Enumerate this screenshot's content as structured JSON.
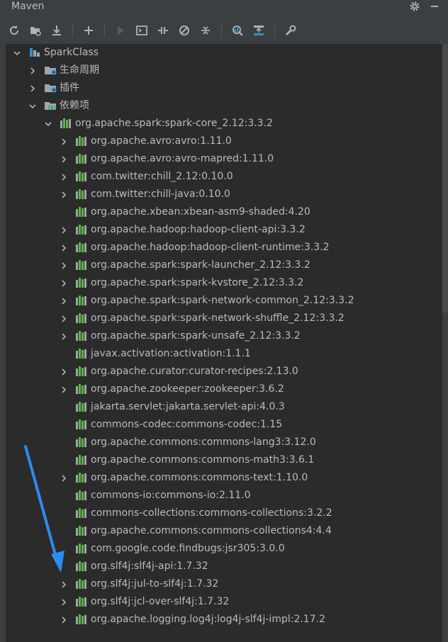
{
  "window": {
    "title": "Maven"
  },
  "toolbar": {
    "buttons": [
      {
        "name": "reload-icon"
      },
      {
        "name": "generate-sources-icon"
      },
      {
        "name": "download-icon"
      },
      {
        "name": "add-icon"
      },
      {
        "name": "run-icon"
      },
      {
        "name": "execute-goal-icon"
      },
      {
        "name": "toggle-offline-icon"
      },
      {
        "name": "skip-tests-icon"
      },
      {
        "name": "collapse-all-icon"
      },
      {
        "name": "analyze-dependencies-icon"
      },
      {
        "name": "show-diagram-icon"
      },
      {
        "name": "settings-wrench-icon"
      }
    ]
  },
  "tree": {
    "rows": [
      {
        "label": "SparkClass",
        "level": 0,
        "expanded": true,
        "icon": "project-icon"
      },
      {
        "label": "生命周期",
        "level": 1,
        "expanded": false,
        "icon": "lifecycle-folder-icon"
      },
      {
        "label": "插件",
        "level": 1,
        "expanded": false,
        "icon": "plugins-folder-icon"
      },
      {
        "label": "依赖项",
        "level": 1,
        "expanded": true,
        "icon": "dependencies-folder-icon"
      },
      {
        "label": "org.apache.spark:spark-core_2.12:3.3.2",
        "level": 2,
        "expanded": true,
        "icon": "library-icon"
      },
      {
        "label": "org.apache.avro:avro:1.11.0",
        "level": 3,
        "expanded": false,
        "icon": "library-icon"
      },
      {
        "label": "org.apache.avro:avro-mapred:1.11.0",
        "level": 3,
        "expanded": false,
        "icon": "library-icon"
      },
      {
        "label": "com.twitter:chill_2.12:0.10.0",
        "level": 3,
        "expanded": false,
        "icon": "library-icon"
      },
      {
        "label": "com.twitter:chill-java:0.10.0",
        "level": 3,
        "expanded": false,
        "icon": "library-icon"
      },
      {
        "label": "org.apache.xbean:xbean-asm9-shaded:4.20",
        "level": 3,
        "leaf": true,
        "icon": "library-icon"
      },
      {
        "label": "org.apache.hadoop:hadoop-client-api:3.3.2",
        "level": 3,
        "expanded": false,
        "icon": "library-icon"
      },
      {
        "label": "org.apache.hadoop:hadoop-client-runtime:3.3.2",
        "level": 3,
        "expanded": false,
        "icon": "library-icon"
      },
      {
        "label": "org.apache.spark:spark-launcher_2.12:3.3.2",
        "level": 3,
        "expanded": false,
        "icon": "library-icon"
      },
      {
        "label": "org.apache.spark:spark-kvstore_2.12:3.3.2",
        "level": 3,
        "expanded": false,
        "icon": "library-icon"
      },
      {
        "label": "org.apache.spark:spark-network-common_2.12:3.3.2",
        "level": 3,
        "expanded": false,
        "icon": "library-icon"
      },
      {
        "label": "org.apache.spark:spark-network-shuffle_2.12:3.3.2",
        "level": 3,
        "expanded": false,
        "icon": "library-icon"
      },
      {
        "label": "org.apache.spark:spark-unsafe_2.12:3.3.2",
        "level": 3,
        "expanded": false,
        "icon": "library-icon"
      },
      {
        "label": "javax.activation:activation:1.1.1",
        "level": 3,
        "leaf": true,
        "icon": "library-icon"
      },
      {
        "label": "org.apache.curator:curator-recipes:2.13.0",
        "level": 3,
        "expanded": false,
        "icon": "library-icon"
      },
      {
        "label": "org.apache.zookeeper:zookeeper:3.6.2",
        "level": 3,
        "expanded": false,
        "icon": "library-icon"
      },
      {
        "label": "jakarta.servlet:jakarta.servlet-api:4.0.3",
        "level": 3,
        "leaf": true,
        "icon": "library-icon"
      },
      {
        "label": "commons-codec:commons-codec:1.15",
        "level": 3,
        "leaf": true,
        "icon": "library-icon"
      },
      {
        "label": "org.apache.commons:commons-lang3:3.12.0",
        "level": 3,
        "leaf": true,
        "icon": "library-icon"
      },
      {
        "label": "org.apache.commons:commons-math3:3.6.1",
        "level": 3,
        "leaf": true,
        "icon": "library-icon"
      },
      {
        "label": "org.apache.commons:commons-text:1.10.0",
        "level": 3,
        "expanded": false,
        "icon": "library-icon"
      },
      {
        "label": "commons-io:commons-io:2.11.0",
        "level": 3,
        "leaf": true,
        "icon": "library-icon"
      },
      {
        "label": "commons-collections:commons-collections:3.2.2",
        "level": 3,
        "leaf": true,
        "icon": "library-icon"
      },
      {
        "label": "org.apache.commons:commons-collections4:4.4",
        "level": 3,
        "leaf": true,
        "icon": "library-icon"
      },
      {
        "label": "com.google.code.findbugs:jsr305:3.0.0",
        "level": 3,
        "leaf": true,
        "icon": "library-icon"
      },
      {
        "label": "org.slf4j:slf4j-api:1.7.32",
        "level": 3,
        "leaf": true,
        "icon": "library-icon"
      },
      {
        "label": "org.slf4j:jul-to-slf4j:1.7.32",
        "level": 3,
        "expanded": false,
        "icon": "library-icon"
      },
      {
        "label": "org.slf4j:jcl-over-slf4j:1.7.32",
        "level": 3,
        "expanded": false,
        "icon": "library-icon"
      },
      {
        "label": "org.apache.logging.log4j:log4j-slf4j-impl:2.17.2",
        "level": 3,
        "expanded": false,
        "icon": "library-icon"
      }
    ]
  },
  "colors": {
    "annotation_arrow": "#2d8cf0",
    "library_icon_green": "#62b543",
    "library_icon_gray": "#9aa7b0",
    "folder_blue": "#3592c4"
  }
}
